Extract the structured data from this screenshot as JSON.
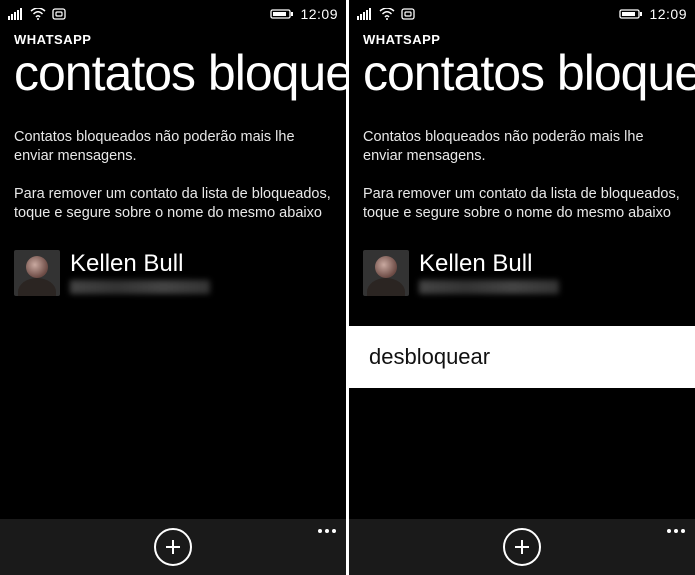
{
  "status": {
    "time": "12:09"
  },
  "app": {
    "name": "WHATSAPP",
    "title": "contatos bloqueados"
  },
  "info": {
    "line1": "Contatos bloqueados não poderão mais lhe enviar mensagens.",
    "line2": "Para remover um contato da lista de bloqueados, toque e segure sobre o nome do mesmo abaixo"
  },
  "contact": {
    "name": "Kellen Bull"
  },
  "context_menu": {
    "unblock": "desbloquear"
  }
}
